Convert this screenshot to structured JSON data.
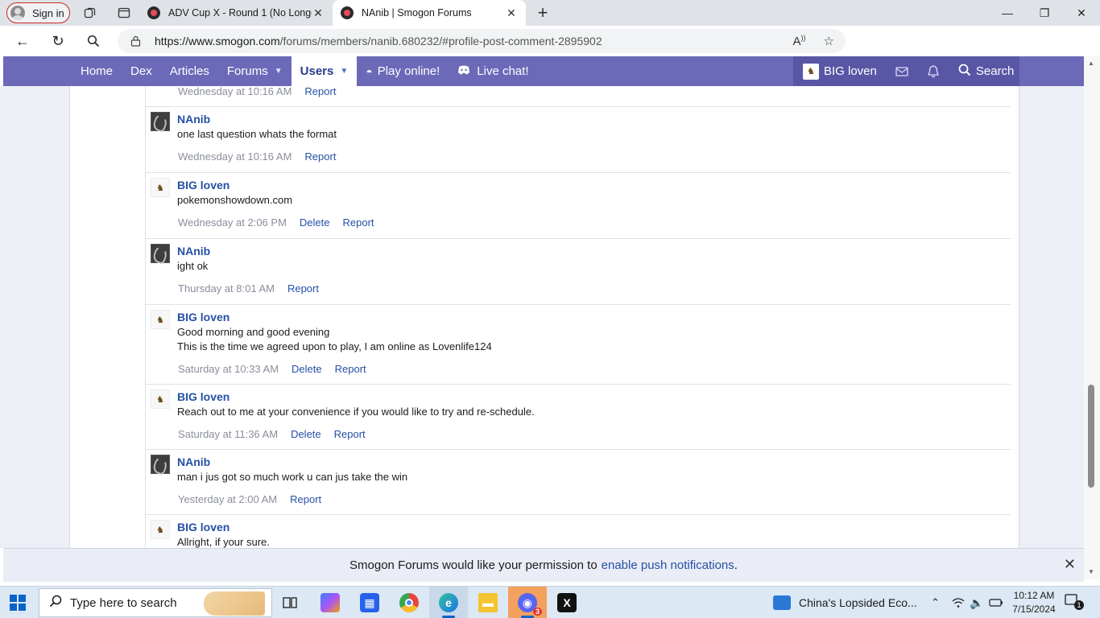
{
  "browser": {
    "signin_label": "Sign in",
    "tabs": [
      {
        "title": "ADV Cup X - Round 1 (No Longer",
        "active": false
      },
      {
        "title": "NAnib | Smogon Forums",
        "active": true
      }
    ],
    "new_tab": "+",
    "url_host": "https://www.smogon.com",
    "url_path": "/forums/members/nanib.680232/#profile-post-comment-2895902"
  },
  "site_nav": {
    "items": [
      {
        "label": "Home"
      },
      {
        "label": "Dex"
      },
      {
        "label": "Articles"
      },
      {
        "label": "Forums"
      },
      {
        "label": "Users"
      },
      {
        "label": "Play online!"
      },
      {
        "label": "Live chat!"
      }
    ],
    "user_name": "BIG loven",
    "search_label": "Search"
  },
  "posts": {
    "partial": {
      "meta": "Wednesday at 10:16 AM",
      "report": "Report"
    },
    "items": [
      {
        "author": "NAnib",
        "lines": [
          "one last question whats the format"
        ],
        "time": "Wednesday at 10:16 AM",
        "delete": "",
        "report": "Report"
      },
      {
        "author": "BIG loven",
        "lines": [
          "pokemonshowdown.com"
        ],
        "time": "Wednesday at 2:06 PM",
        "delete": "Delete",
        "report": "Report"
      },
      {
        "author": "NAnib",
        "lines": [
          "ight ok"
        ],
        "time": "Thursday at 8:01 AM",
        "delete": "",
        "report": "Report"
      },
      {
        "author": "BIG loven",
        "lines": [
          "Good morning and good evening",
          "This is the time we agreed upon to play, I am online as Lovenlife124"
        ],
        "time": "Saturday at 10:33 AM",
        "delete": "Delete",
        "report": "Report"
      },
      {
        "author": "BIG loven",
        "lines": [
          "Reach out to me at your convenience if you would like to try and re-schedule."
        ],
        "time": "Saturday at 11:36 AM",
        "delete": "Delete",
        "report": "Report"
      },
      {
        "author": "NAnib",
        "lines": [
          "man i jus got so much work u can jus take the win"
        ],
        "time": "Yesterday at 2:00 AM",
        "delete": "",
        "report": "Report"
      },
      {
        "author": "BIG loven",
        "lines": [
          "Allright, if your sure."
        ],
        "time": "",
        "delete": "",
        "report": ""
      }
    ]
  },
  "notice": {
    "text": "Smogon Forums would like your permission to",
    "link": "enable push notifications",
    "end": "."
  },
  "taskbar": {
    "search_placeholder": "Type here to search",
    "news": "China's Lopsided Eco...",
    "time": "10:12 AM",
    "date": "7/15/2024",
    "discord_badge": "3",
    "notif_count": "1"
  }
}
